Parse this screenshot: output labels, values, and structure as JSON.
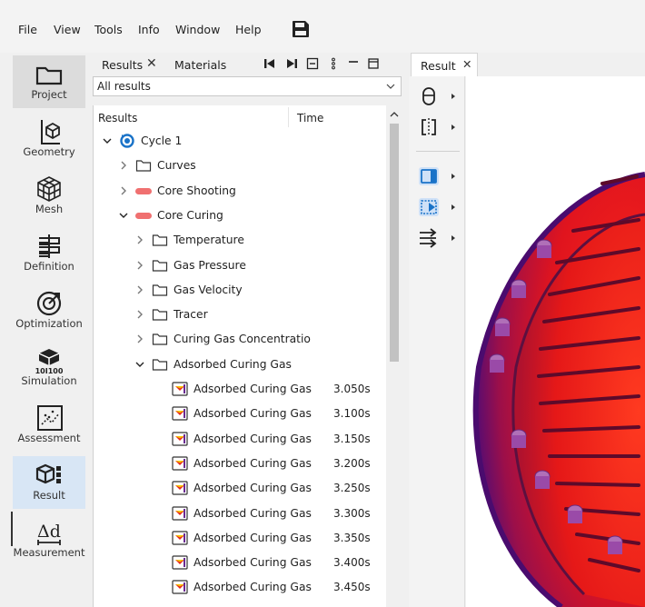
{
  "menu": {
    "items": [
      "File",
      "View",
      "Tools",
      "Info",
      "Window",
      "Help"
    ]
  },
  "nav": {
    "items": [
      {
        "label": "Project",
        "icon": "folder-icon"
      },
      {
        "label": "Geometry",
        "icon": "geometry-icon"
      },
      {
        "label": "Mesh",
        "icon": "mesh-icon"
      },
      {
        "label": "Definition",
        "icon": "definition-icon"
      },
      {
        "label": "Optimization",
        "icon": "optimization-icon"
      },
      {
        "label": "Simulation",
        "icon": "simulation-icon"
      },
      {
        "label": "Assessment",
        "icon": "assessment-icon"
      },
      {
        "label": "Result",
        "icon": "result-icon"
      },
      {
        "label": "Measurement",
        "icon": "measurement-icon"
      }
    ],
    "active": "Result"
  },
  "results_panel": {
    "tabs": [
      "Results",
      "Materials"
    ],
    "filter": "All results",
    "columns": [
      "Results",
      "Time"
    ],
    "tree": [
      {
        "label": "Cycle 1",
        "level": 0,
        "icon": "cycle-icon",
        "expanded": true
      },
      {
        "label": "Curves",
        "level": 1,
        "icon": "folder-icon",
        "expanded": false
      },
      {
        "label": "Core Shooting",
        "level": 1,
        "icon": "core-icon",
        "expanded": false
      },
      {
        "label": "Core Curing",
        "level": 1,
        "icon": "core-icon",
        "expanded": true
      },
      {
        "label": "Temperature",
        "level": 2,
        "icon": "folder-icon",
        "expanded": false
      },
      {
        "label": "Gas Pressure",
        "level": 2,
        "icon": "folder-icon",
        "expanded": false
      },
      {
        "label": "Gas Velocity",
        "level": 2,
        "icon": "folder-icon",
        "expanded": false
      },
      {
        "label": "Tracer",
        "level": 2,
        "icon": "folder-icon",
        "expanded": false
      },
      {
        "label": "Curing Gas Concentratio",
        "level": 2,
        "icon": "folder-icon",
        "expanded": false
      },
      {
        "label": "Adsorbed Curing Gas",
        "level": 2,
        "icon": "folder-icon",
        "expanded": true
      },
      {
        "label": "Adsorbed Curing Gas",
        "level": 3,
        "icon": "result-file-icon",
        "time": "3.050s"
      },
      {
        "label": "Adsorbed Curing Gas",
        "level": 3,
        "icon": "result-file-icon",
        "time": "3.100s"
      },
      {
        "label": "Adsorbed Curing Gas",
        "level": 3,
        "icon": "result-file-icon",
        "time": "3.150s"
      },
      {
        "label": "Adsorbed Curing Gas",
        "level": 3,
        "icon": "result-file-icon",
        "time": "3.200s"
      },
      {
        "label": "Adsorbed Curing Gas",
        "level": 3,
        "icon": "result-file-icon",
        "time": "3.250s"
      },
      {
        "label": "Adsorbed Curing Gas",
        "level": 3,
        "icon": "result-file-icon",
        "time": "3.300s"
      },
      {
        "label": "Adsorbed Curing Gas",
        "level": 3,
        "icon": "result-file-icon",
        "time": "3.350s"
      },
      {
        "label": "Adsorbed Curing Gas",
        "level": 3,
        "icon": "result-file-icon",
        "time": "3.400s"
      },
      {
        "label": "Adsorbed Curing Gas",
        "level": 3,
        "icon": "result-file-icon",
        "time": "3.450s"
      }
    ]
  },
  "viewer": {
    "tab": "Result"
  },
  "colors": {
    "accent": "#1a73c8",
    "active_nav": "#d8e6f5",
    "core_pink": "#f07070"
  }
}
